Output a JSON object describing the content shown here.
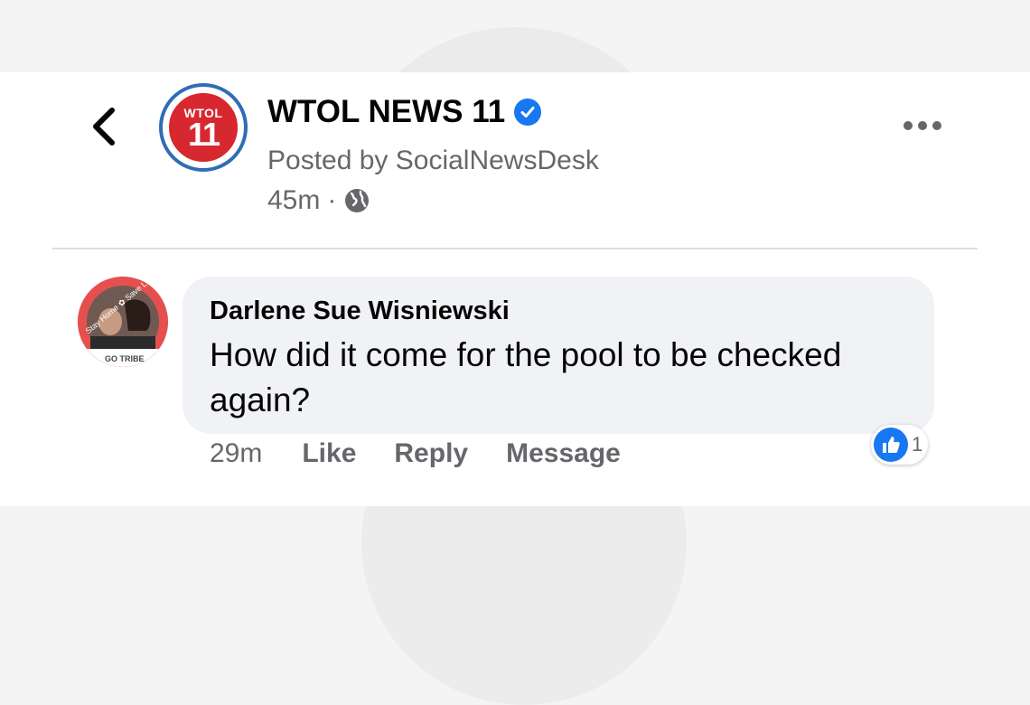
{
  "header": {
    "back_icon": "chevron-left-icon",
    "page_logo": {
      "top_text": "WTOL",
      "number": "11"
    },
    "page_name": "WTOL NEWS 11",
    "verified_icon": "verified-badge-icon",
    "posted_by": "Posted by SocialNewsDesk",
    "time": "45m",
    "separator": "·",
    "audience_icon": "globe-icon",
    "more_icon": "more-horizontal-icon"
  },
  "comment": {
    "author": "Darlene Sue Wisniewski",
    "avatar_text": {
      "top": "Stay Home ✿ Save Lives",
      "bottom": "GO TRIBE"
    },
    "text": "How did it come for the pool to be checked again?",
    "time": "29m",
    "like_label": "Like",
    "reply_label": "Reply",
    "message_label": "Message",
    "reaction_icon": "thumbs-up-icon",
    "reaction_count": "1"
  },
  "colors": {
    "brand_blue": "#1877f2",
    "logo_red": "#d7282f",
    "logo_ring": "#2f6db5",
    "secondary_text": "#65676b",
    "bubble": "#f0f2f5"
  }
}
